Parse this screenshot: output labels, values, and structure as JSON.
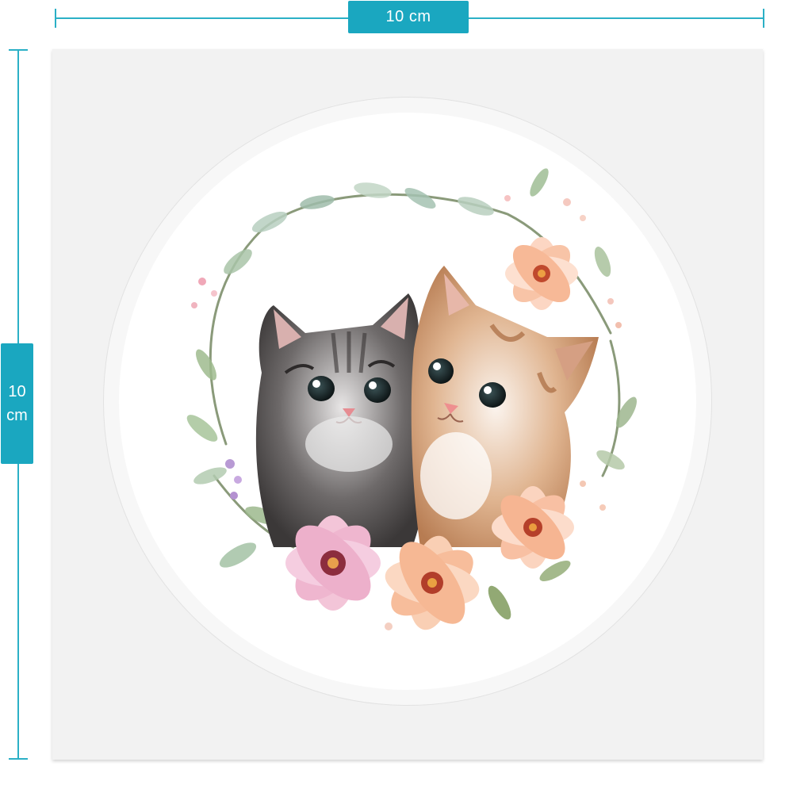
{
  "dimensions": {
    "width_label": "10 cm",
    "height_label_line1": "10",
    "height_label_line2": "cm"
  },
  "colors": {
    "accent": "#1aa7c0",
    "sheet": "#f2f2f2",
    "sticker": "#ffffff"
  },
  "artwork": {
    "icon": "kittens-flower-wreath-illustration"
  }
}
